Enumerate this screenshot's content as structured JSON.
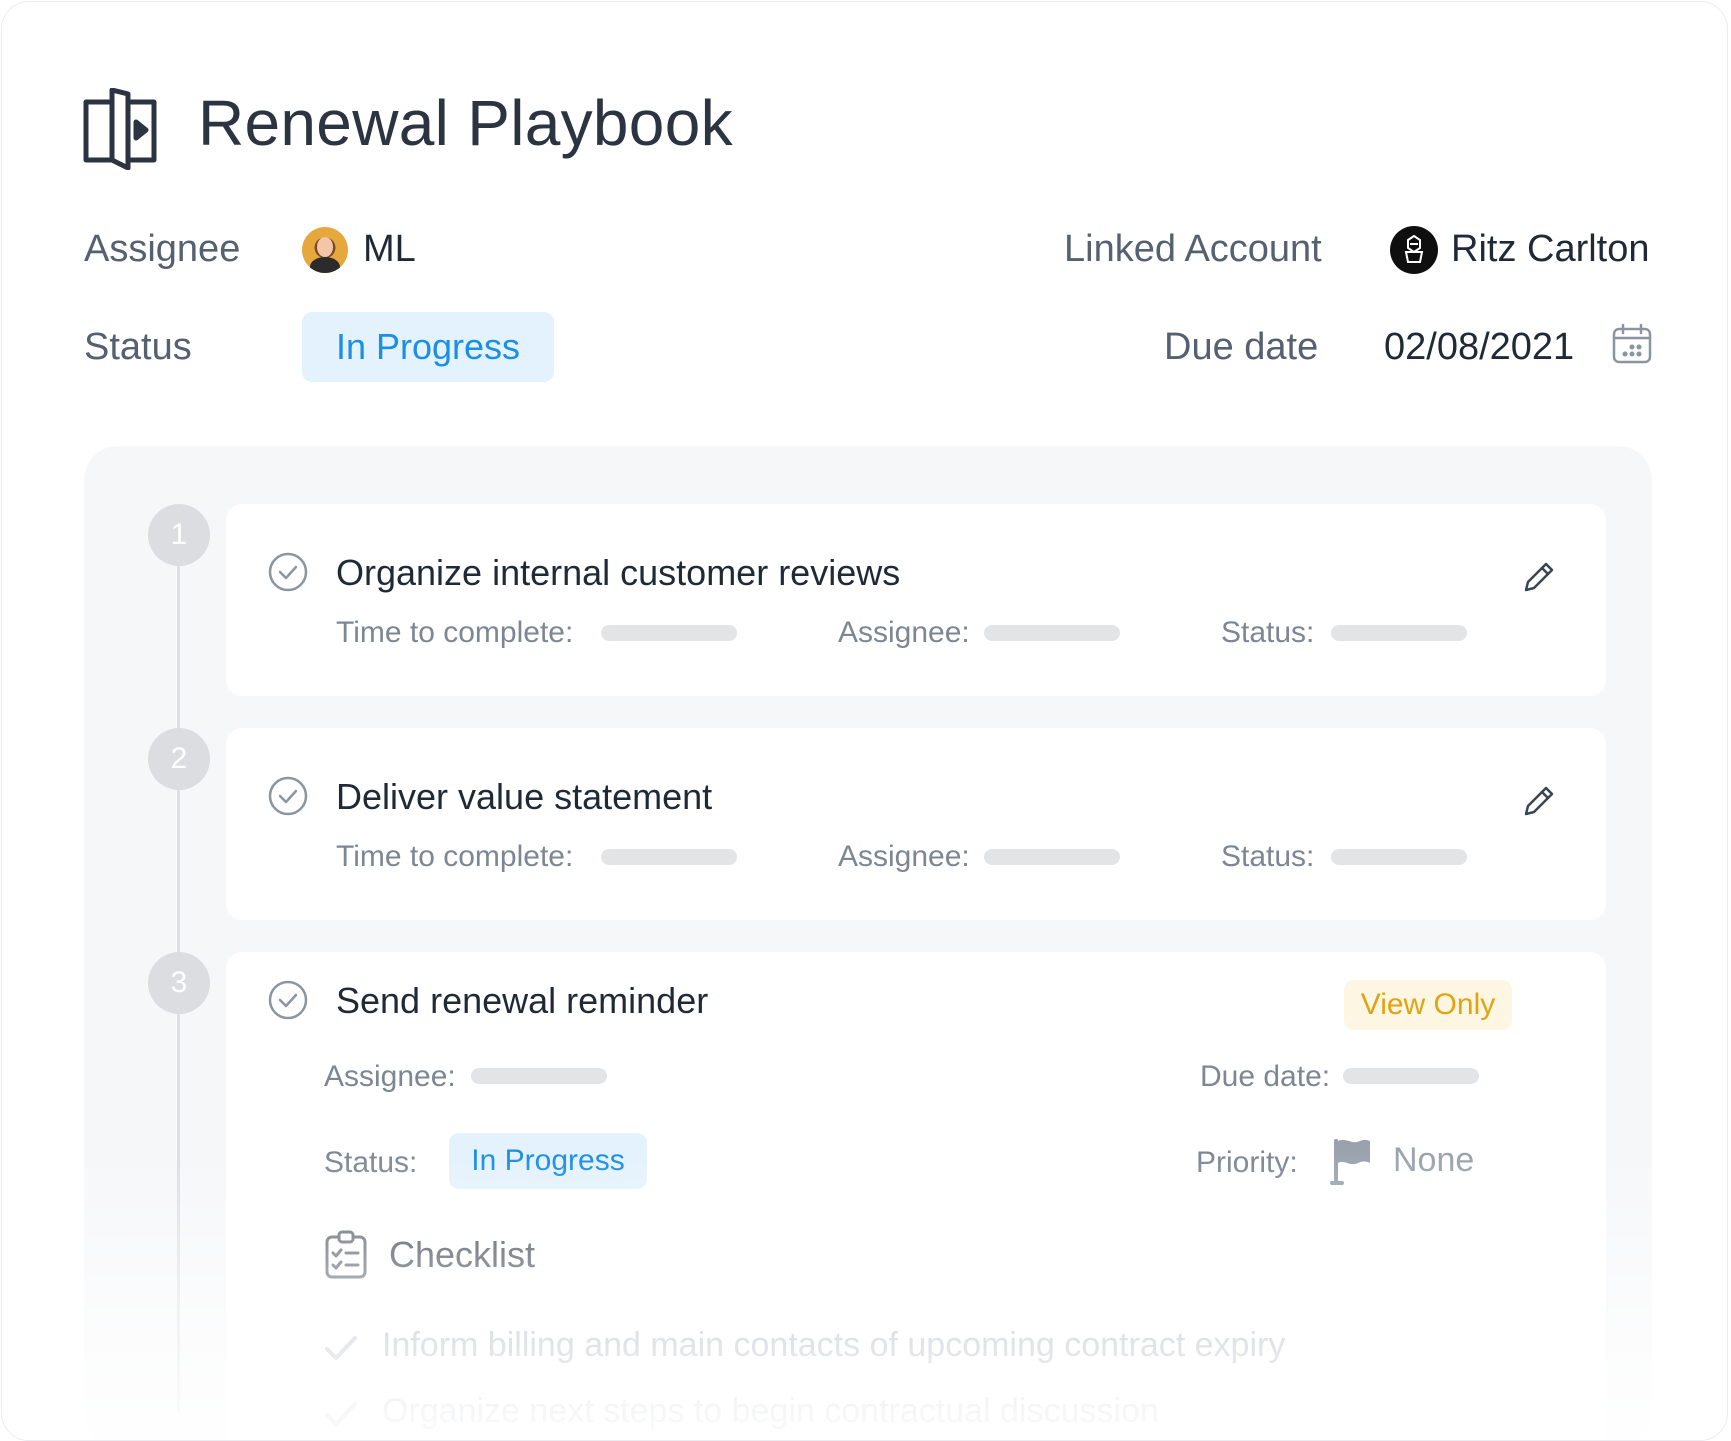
{
  "header": {
    "title": "Renewal Playbook",
    "icon": "playbook-icon"
  },
  "meta": {
    "assignee_label": "Assignee",
    "assignee_initials": "ML",
    "linked_account_label": "Linked Account",
    "linked_account_name": "Ritz Carlton",
    "status_label": "Status",
    "status_value": "In Progress",
    "due_date_label": "Due date",
    "due_date_value": "02/08/2021"
  },
  "steps": [
    {
      "number": "1",
      "title": "Organize internal customer reviews",
      "time_label": "Time to complete:",
      "assignee_label": "Assignee:",
      "status_label": "Status:"
    },
    {
      "number": "2",
      "title": "Deliver value statement",
      "time_label": "Time to complete:",
      "assignee_label": "Assignee:",
      "status_label": "Status:"
    },
    {
      "number": "3",
      "title": "Send renewal reminder",
      "badge": "View Only",
      "assignee_label": "Assignee:",
      "due_date_label": "Due date:",
      "status_label": "Status:",
      "status_value": "In Progress",
      "priority_label": "Priority:",
      "priority_value": "None",
      "checklist_title": "Checklist",
      "checklist_items": [
        "Inform billing and main contacts of upcoming contract expiry",
        "Organize next steps to begin contractual discussion"
      ]
    }
  ],
  "colors": {
    "accent_blue": "#1a8fe3",
    "pill_blue_bg": "#e4f2fd",
    "view_only_text": "#e0a412",
    "view_only_bg": "#fdf6e2",
    "text_dark": "#1f2a36",
    "text_muted": "#7d8793"
  }
}
